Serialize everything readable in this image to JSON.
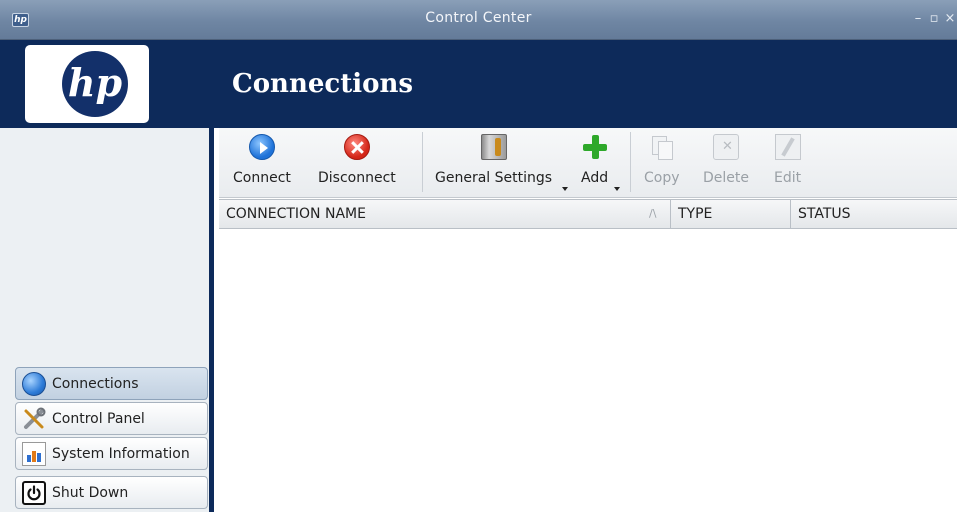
{
  "window": {
    "title": "Control Center",
    "controls": [
      "–",
      "▫",
      "×"
    ]
  },
  "header": {
    "logo_text": "hp",
    "page_title": "Connections",
    "colors": {
      "header_bg": "#0d2a5a",
      "logo_bg": "#13306a"
    }
  },
  "toolbar": {
    "connect": "Connect",
    "disconnect": "Disconnect",
    "general_settings": "General Settings",
    "add": "Add",
    "copy": "Copy",
    "delete": "Delete",
    "edit": "Edit"
  },
  "table": {
    "columns": [
      "CONNECTION NAME",
      "TYPE",
      "STATUS"
    ],
    "sort_indicator": "/\\",
    "rows": []
  },
  "sidebar": {
    "items": [
      {
        "label": "Connections",
        "icon": "globe-icon",
        "active": true
      },
      {
        "label": "Control Panel",
        "icon": "tools-icon",
        "active": false
      },
      {
        "label": "System Information",
        "icon": "system-info-icon",
        "active": false
      },
      {
        "label": "Shut Down",
        "icon": "power-icon",
        "active": false
      }
    ]
  }
}
